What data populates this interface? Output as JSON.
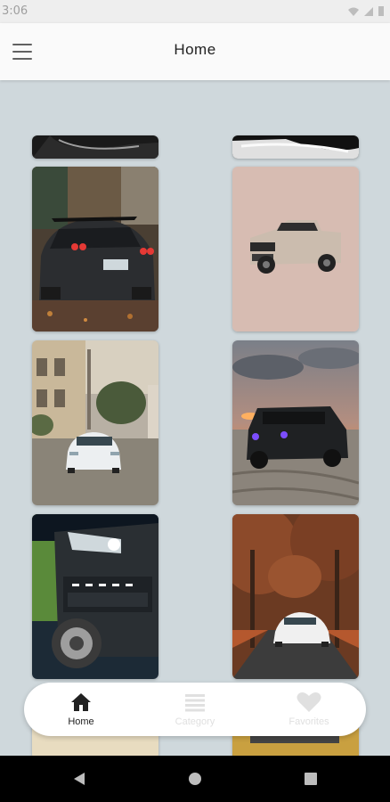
{
  "status_bar": {
    "time": "3:06"
  },
  "app_bar": {
    "title": "Home"
  },
  "wallpapers": [
    {
      "label": "Sports car rear, red taillights"
    },
    {
      "label": "Beige pickup truck"
    },
    {
      "label": "White sedan on street"
    },
    {
      "label": "Black SUV at sunset beach"
    },
    {
      "label": "Dark pickup front closeup"
    },
    {
      "label": "White sports car in autumn"
    }
  ],
  "bottom_nav": {
    "items": [
      {
        "label": "Home",
        "icon": "home-icon",
        "active": true
      },
      {
        "label": "Category",
        "icon": "category-icon",
        "active": false
      },
      {
        "label": "Favorites",
        "icon": "heart-icon",
        "active": false
      }
    ]
  },
  "colors": {
    "background": "#cfd8dc",
    "active": "#212121",
    "inactive": "#e0e0e0"
  }
}
